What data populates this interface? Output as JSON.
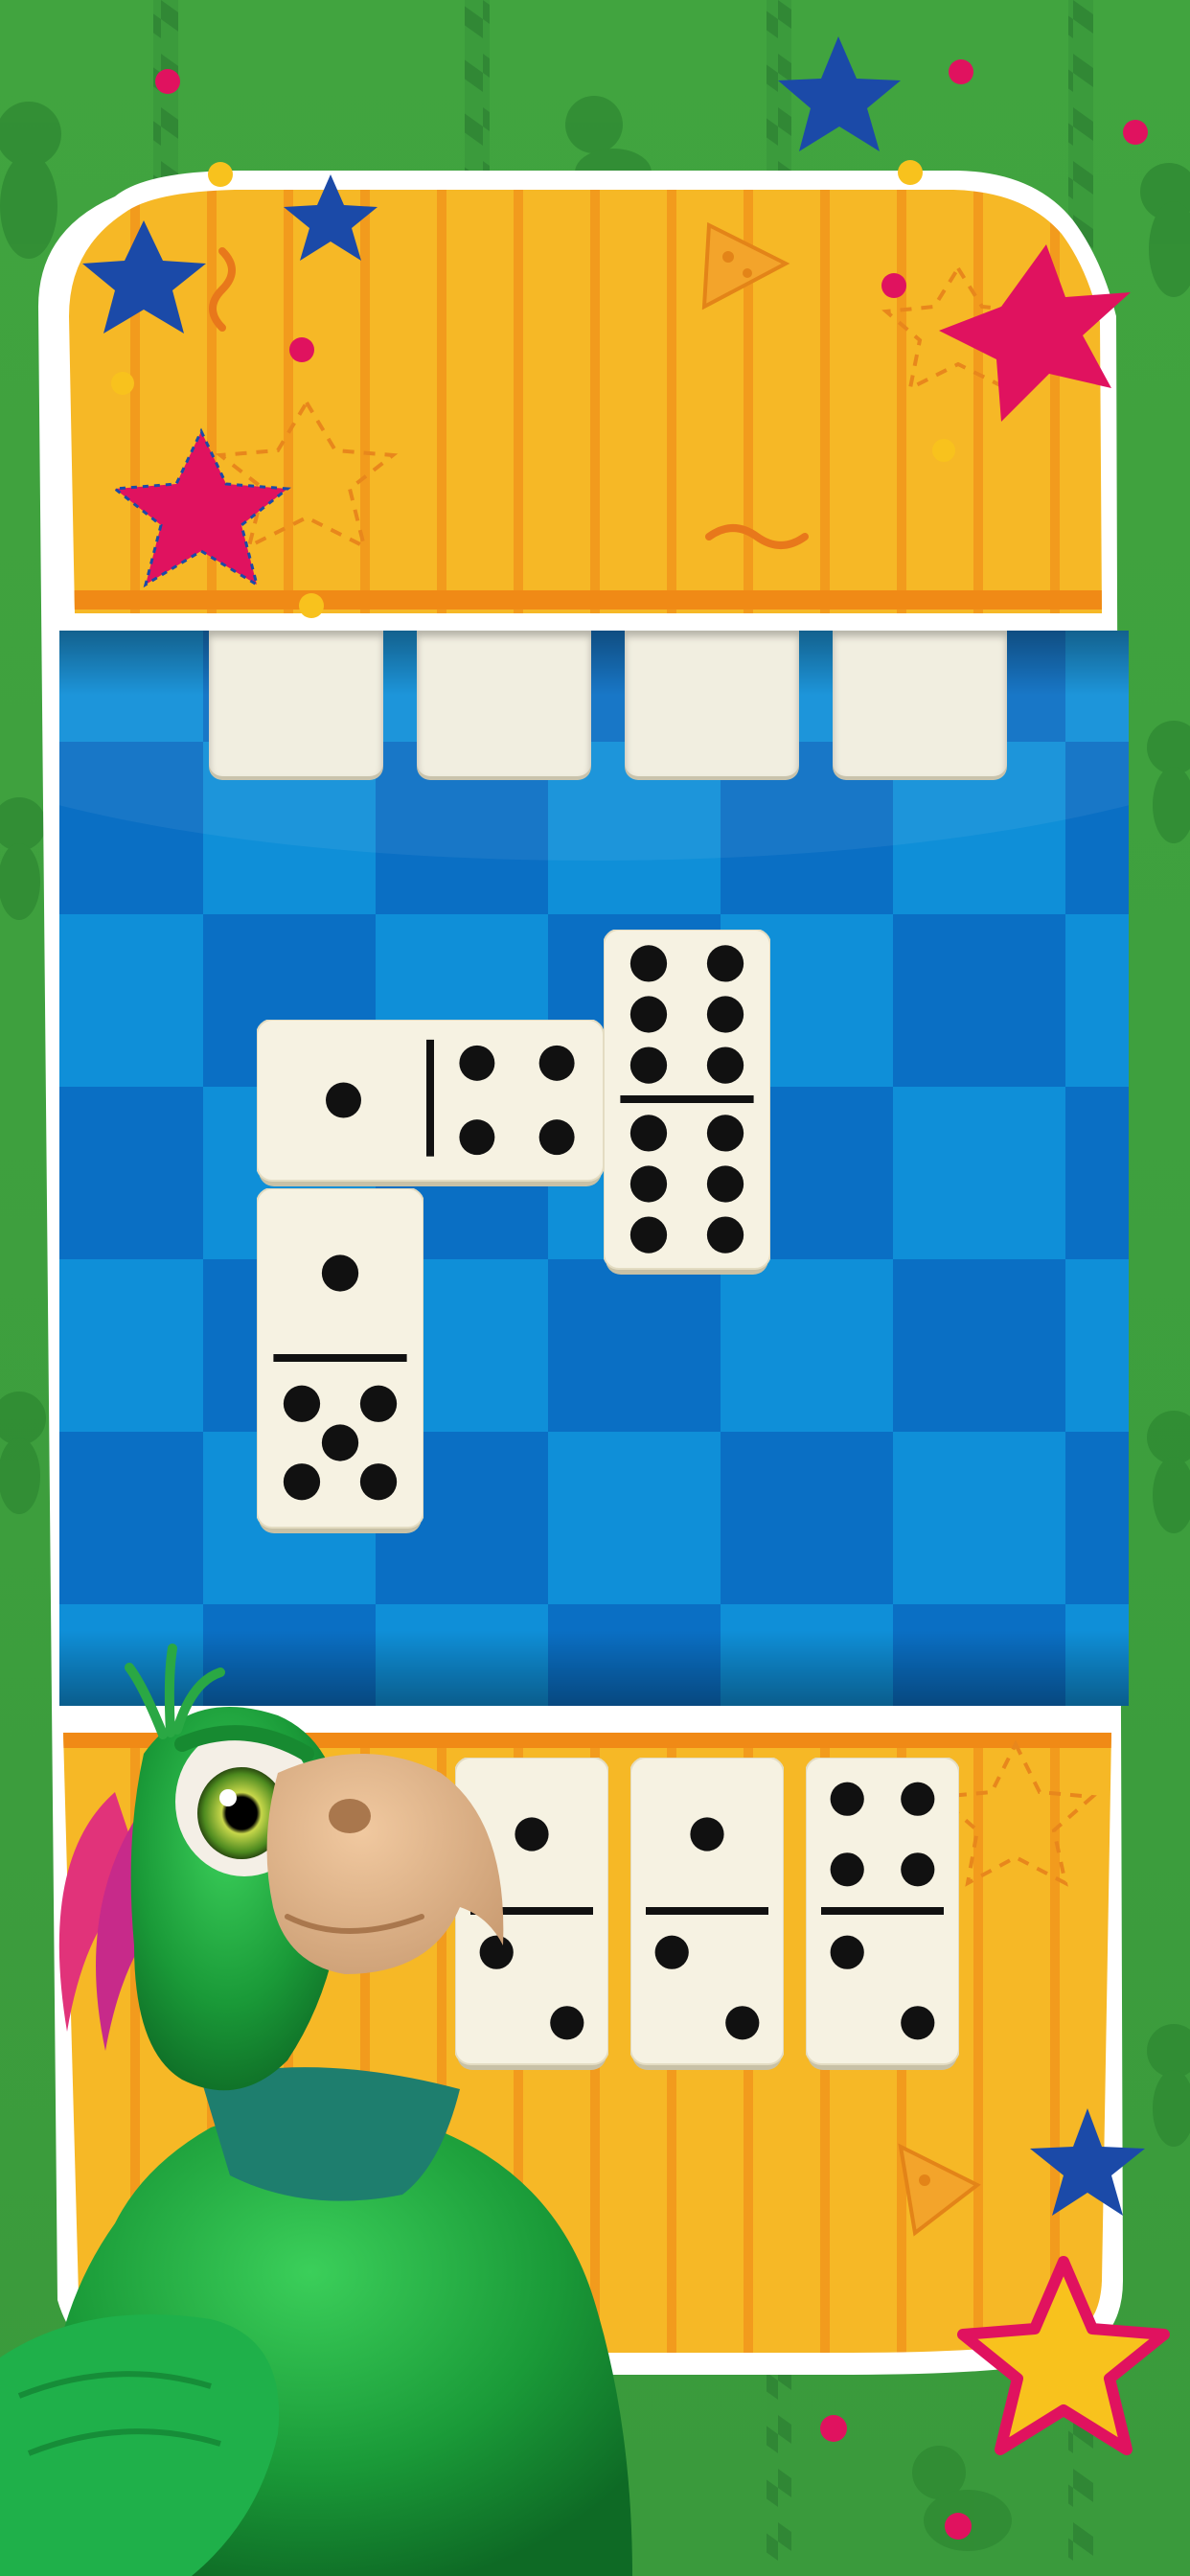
{
  "colors": {
    "background_green": "#3a9a3c",
    "panel_yellow": "#f6b826",
    "stripe_orange": "#f39a1c",
    "board_blue_light": "#0f8fd8",
    "board_blue_dark": "#0a6fc4",
    "tile_ivory": "#f6f2e2",
    "pip_black": "#111111",
    "star_pink": "#e0125f",
    "star_blue": "#1b4aa8",
    "star_yellow": "#f8c21d",
    "parrot_green": "#1f9a3a"
  },
  "opponent_hand": {
    "face_down_tiles": 4
  },
  "board": {
    "tiles": [
      {
        "name": "domino-1-4",
        "values": [
          1,
          4
        ],
        "orientation": "horizontal"
      },
      {
        "name": "domino-6-6",
        "values": [
          6,
          6
        ],
        "orientation": "vertical"
      },
      {
        "name": "domino-1-5",
        "values": [
          1,
          5
        ],
        "orientation": "vertical"
      }
    ]
  },
  "player_hand": {
    "tiles": [
      {
        "name": "hand-domino-1-2",
        "values": [
          1,
          2
        ]
      },
      {
        "name": "hand-domino-1-2b",
        "values": [
          1,
          2
        ]
      },
      {
        "name": "hand-domino-4-2",
        "values": [
          4,
          2
        ]
      }
    ]
  },
  "character": {
    "icon": "parrot-mascot"
  }
}
